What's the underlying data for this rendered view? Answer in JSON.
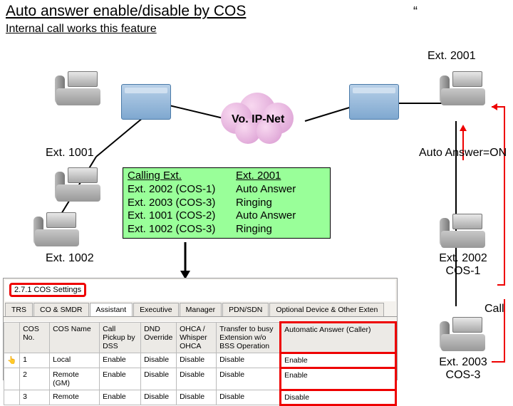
{
  "title": "Auto answer enable/disable by COS",
  "subtitle": "Internal call works this feature",
  "quote": "“",
  "cloud_label": "Vo. IP-Net",
  "labels": {
    "ext2001": "Ext. 2001",
    "ext1001": "Ext. 1001",
    "ext1002": "Ext. 1002",
    "auto_on": "Auto Answer=ON",
    "ext2002_l1": "Ext. 2002",
    "ext2002_l2": "COS-1",
    "ext2003_l1": "Ext. 2003",
    "ext2003_l2": "COS-3",
    "call": "Call"
  },
  "green": {
    "h1": "Calling Ext.",
    "h2": "Ext. 2001",
    "rows": [
      {
        "c1": "Ext. 2002 (COS-1)",
        "c2": "Auto Answer"
      },
      {
        "c1": "Ext. 2003 (COS-3)",
        "c2": "Ringing"
      },
      {
        "c1": "Ext. 1001 (COS-2)",
        "c2": "Auto Answer"
      },
      {
        "c1": "Ext. 1002 (COS-3)",
        "c2": "Ringing"
      }
    ]
  },
  "cos": {
    "path": "2.7.1 COS Settings",
    "tabs": [
      "TRS",
      "CO & SMDR",
      "Assistant",
      "Executive",
      "Manager",
      "PDN/SDN",
      "Optional Device & Other Exten"
    ],
    "active_tab": 2,
    "headers": [
      "",
      "COS No.",
      "COS Name",
      "Call Pickup by DSS",
      "DND Override",
      "OHCA / Whisper OHCA",
      "Transfer to busy Extension w/o BSS Operation",
      "Automatic Answer (Caller)"
    ],
    "rows": [
      {
        "hand": true,
        "no": "1",
        "name": "Local",
        "pk": "Enable",
        "dnd": "Disable",
        "ohca": "Disable",
        "xfer": "Disable",
        "auto": "Enable"
      },
      {
        "hand": false,
        "no": "2",
        "name": "Remote (GM)",
        "pk": "Enable",
        "dnd": "Disable",
        "ohca": "Disable",
        "xfer": "Disable",
        "auto": "Enable"
      },
      {
        "hand": false,
        "no": "3",
        "name": "Remote",
        "pk": "Enable",
        "dnd": "Disable",
        "ohca": "Disable",
        "xfer": "Disable",
        "auto": "Disable"
      }
    ]
  }
}
